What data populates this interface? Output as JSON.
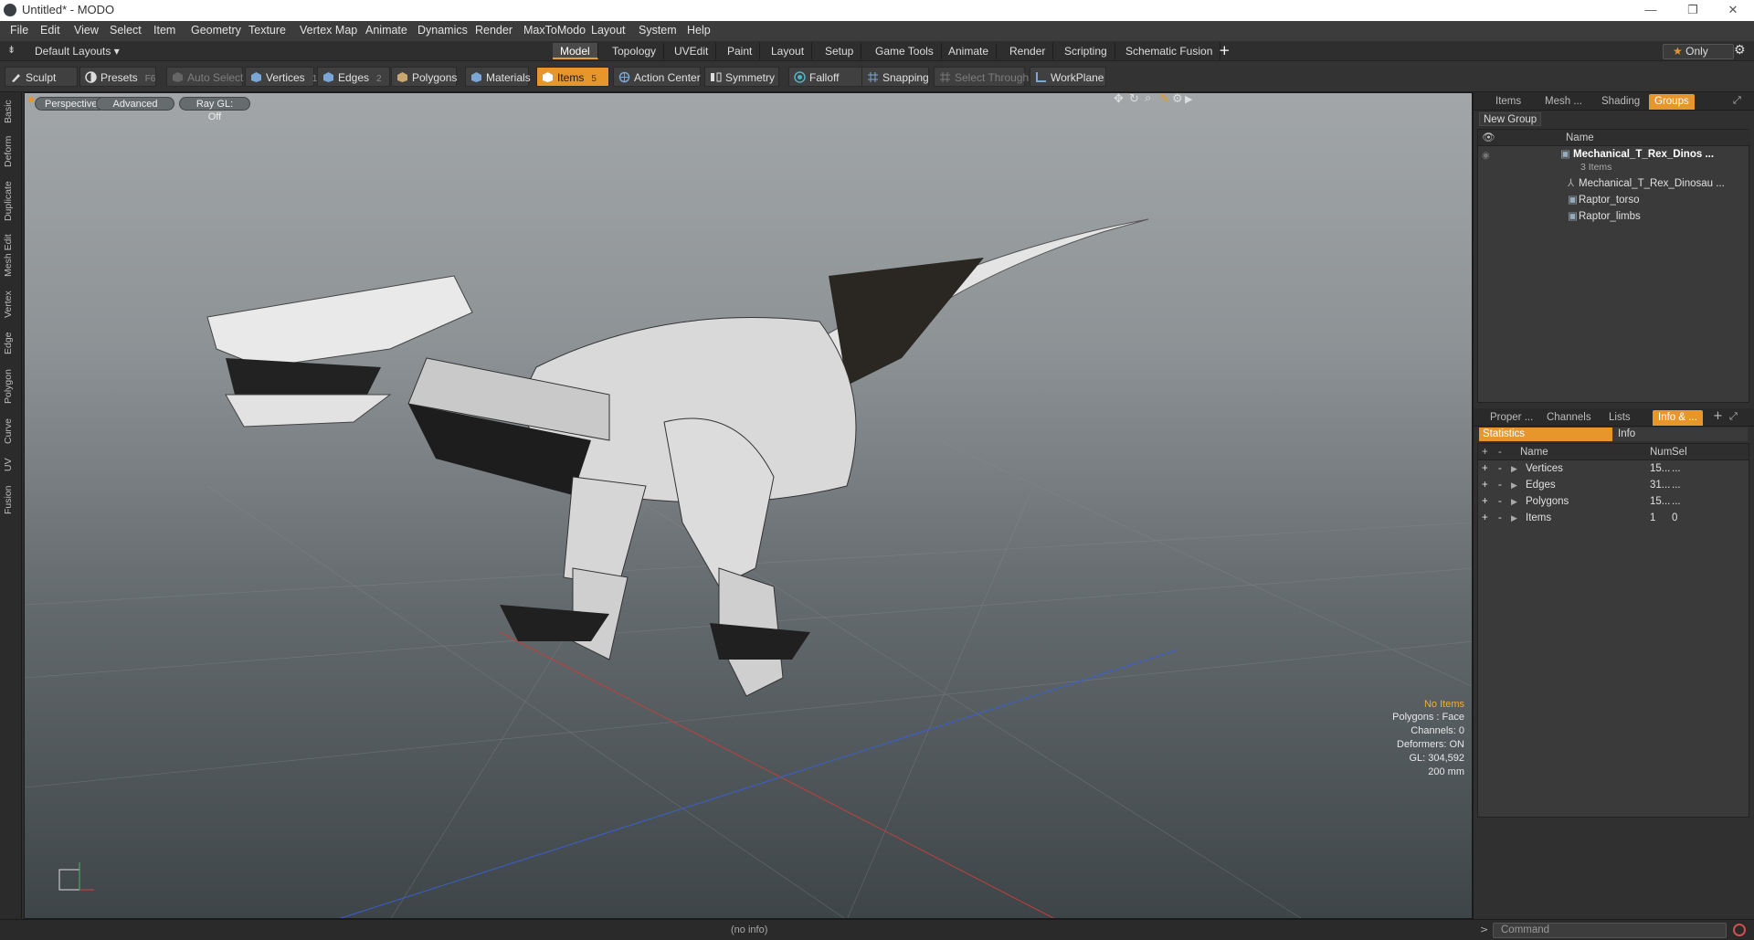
{
  "window": {
    "title": "Untitled* - MODO",
    "minimize": "—",
    "maximize": "❐",
    "close": "✕"
  },
  "menu": [
    "File",
    "Edit",
    "View",
    "Select",
    "Item",
    "Geometry",
    "Texture",
    "Vertex Map",
    "Animate",
    "Dynamics",
    "Render",
    "MaxToModo",
    "Layout",
    "System",
    "Help"
  ],
  "layout_bar": {
    "layout_dropdown": "Default Layouts ▾",
    "tabs": [
      "Model",
      "Topology",
      "UVEdit",
      "Paint",
      "Layout",
      "Setup",
      "Game Tools",
      "Animate",
      "Render",
      "Scripting",
      "Schematic Fusion"
    ],
    "active_tab": "Model",
    "add": "+",
    "only_label": "Only"
  },
  "toolbar": {
    "sculpt": "Sculpt",
    "presets": "Presets",
    "presets_key": "F6",
    "auto_select": "Auto Select",
    "vertices": "Vertices",
    "vertices_key": "1",
    "edges": "Edges",
    "edges_key": "2",
    "polygons": "Polygons",
    "materials": "Materials",
    "items": "Items",
    "items_key": "5",
    "action_center": "Action Center",
    "symmetry": "Symmetry",
    "falloff": "Falloff",
    "snapping": "Snapping",
    "select_through": "Select Through",
    "workplane": "WorkPlane"
  },
  "left_tabs": [
    "Basic",
    "Deform",
    "Duplicate",
    "Mesh Edit",
    "Vertex",
    "Edge",
    "Polygon",
    "Curve",
    "UV",
    "Fusion"
  ],
  "viewport": {
    "perspective": "Perspective",
    "advanced": "Advanced",
    "raygl": "Ray GL: Off",
    "info": {
      "no_items": "No Items",
      "polygons": "Polygons : Face",
      "channels": "Channels: 0",
      "deformers": "Deformers: ON",
      "gl": "GL: 304,592",
      "scale": "200 mm"
    }
  },
  "groups_panel": {
    "tabs": [
      "Items",
      "Mesh ...",
      "Shading",
      "Groups"
    ],
    "active_tab": "Groups",
    "new_group": "New Group",
    "name_header": "Name",
    "group_name": "Mechanical_T_Rex_Dinos ...",
    "group_count": "3 Items",
    "children": [
      "Mechanical_T_Rex_Dinosau ...",
      "Raptor_torso",
      "Raptor_limbs"
    ]
  },
  "info_panel": {
    "tabs": [
      "Proper ...",
      "Channels",
      "Lists",
      "Info & ..."
    ],
    "active_tab": "Info & ...",
    "subtabs": [
      "Statistics",
      "Info"
    ],
    "headers": {
      "name": "Name",
      "num": "Num",
      "sel": "Sel"
    },
    "rows": [
      {
        "name": "Vertices",
        "num": "15...",
        "sel": "..."
      },
      {
        "name": "Edges",
        "num": "31...",
        "sel": "..."
      },
      {
        "name": "Polygons",
        "num": "15...",
        "sel": "..."
      },
      {
        "name": "Items",
        "num": "1",
        "sel": "0"
      }
    ]
  },
  "status": {
    "info": "(no info)",
    "command_placeholder": "Command"
  },
  "colors": {
    "accent": "#e6962a",
    "panel": "#303030",
    "viewport_top": "#a2a6a8",
    "viewport_bottom": "#3e4549"
  }
}
